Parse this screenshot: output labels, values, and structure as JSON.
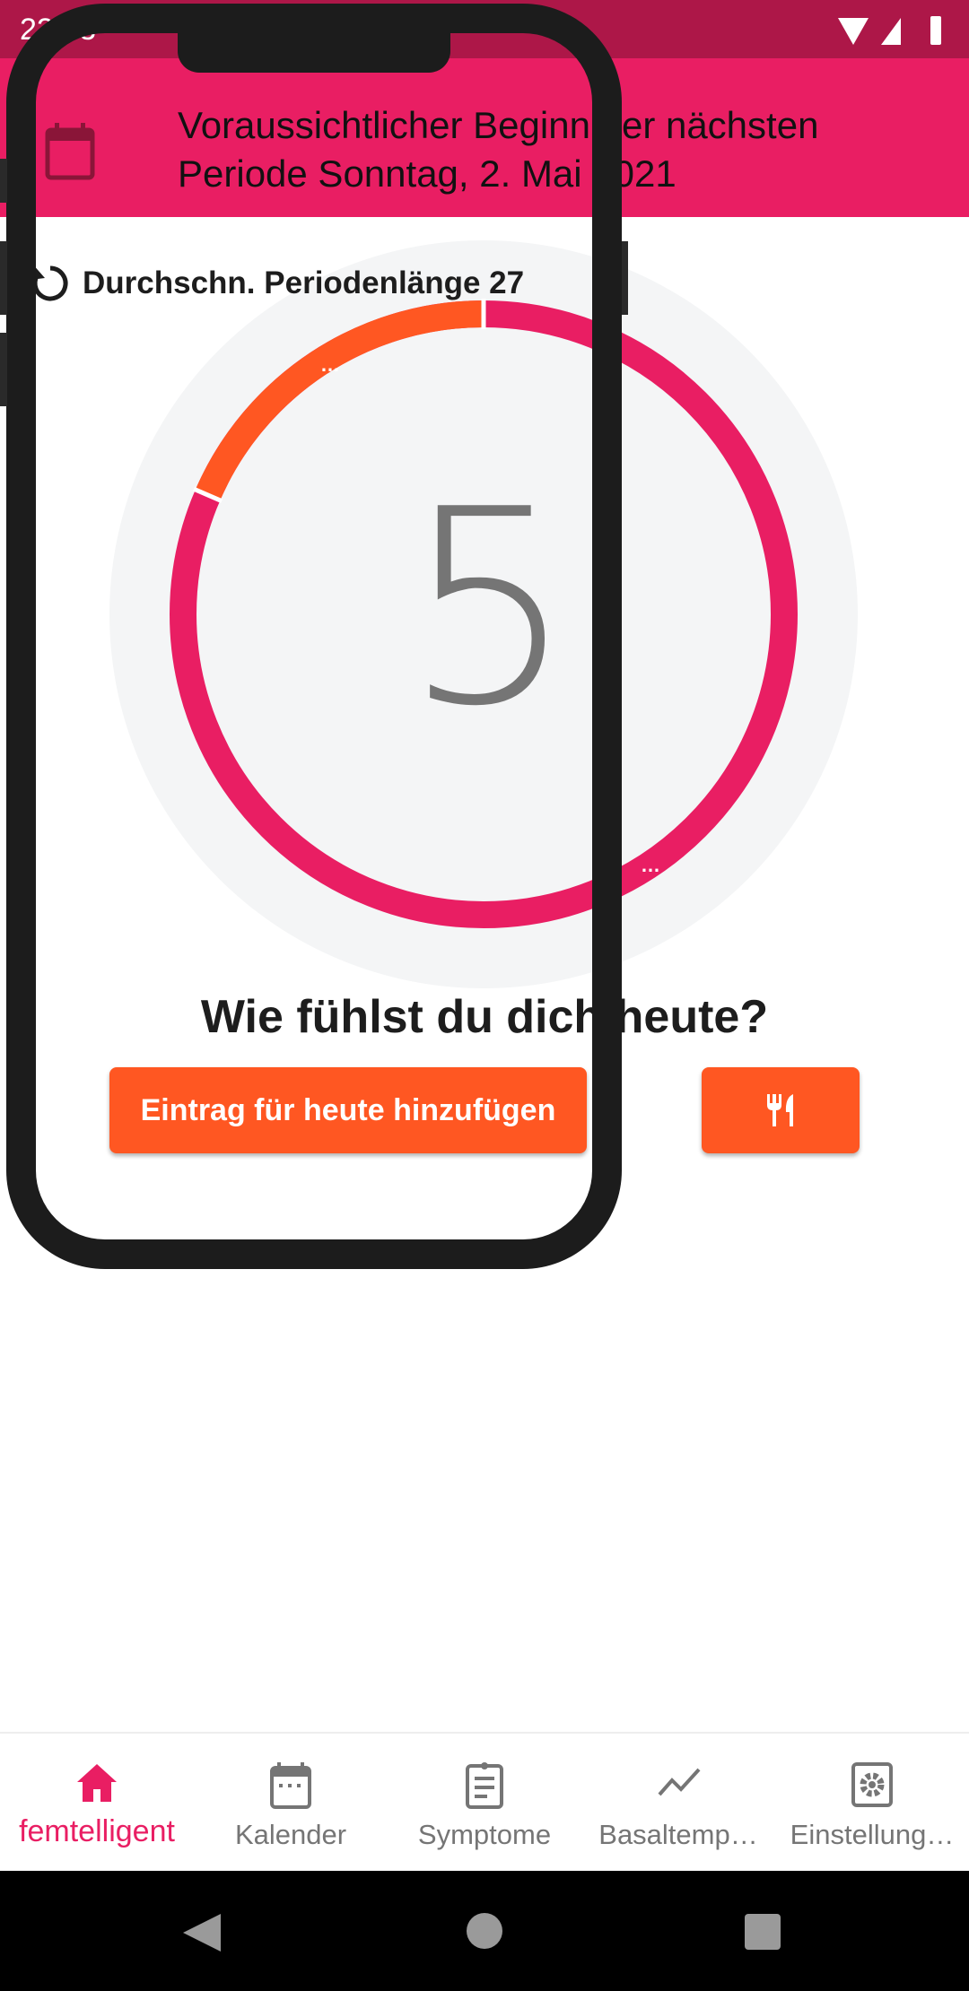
{
  "status_bar": {
    "time": "22:53"
  },
  "header": {
    "line1": "Voraussichtlicher Beginn der nächsten",
    "line2": "Periode Sonntag, 2. Mai 2021",
    "icon": "calendar-icon"
  },
  "cycle": {
    "avg_label": "Durchschn. Periodenlänge 27",
    "day": "5",
    "period_fraction": 0.185,
    "colors": {
      "period": "#ff5722",
      "cycle": "#e91e63"
    }
  },
  "question": "Wie fühlst du dich heute?",
  "actions": {
    "add_entry": "Eintrag für heute hinzufügen",
    "food_icon": "fork-knife-icon"
  },
  "bottom_nav": [
    {
      "label": "femtelligent",
      "icon": "home-icon",
      "active": true
    },
    {
      "label": "Kalender",
      "icon": "calendar-icon"
    },
    {
      "label": "Symptome",
      "icon": "clipboard-icon"
    },
    {
      "label": "Basaltemp…",
      "icon": "chart-line-icon"
    },
    {
      "label": "Einstellung…",
      "icon": "settings-icon"
    }
  ],
  "colors": {
    "primary": "#e91e63",
    "primary_dark": "#ad1748",
    "accent": "#ff5722"
  }
}
